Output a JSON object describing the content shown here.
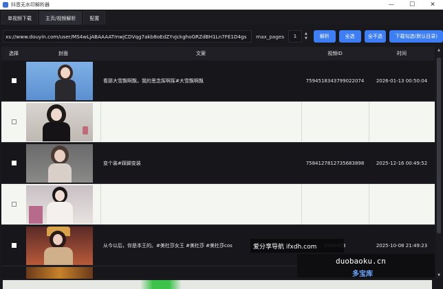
{
  "window": {
    "title": "抖音无水印解析器",
    "min_glyph": "—",
    "max_glyph": "☐",
    "close_glyph": "✕"
  },
  "tabs": [
    "单视频下载",
    "主页/视频解析",
    "配置"
  ],
  "toolbar": {
    "url_value": "xs://www.douyin.com/user/MS4wLjABAAAATmwjCDVqg7akb8oEdZYvJckghoGRZdBH1Ln7FE1D4gs",
    "max_pages_label": "max_pages",
    "max_pages_value": "1",
    "parse_button": "解析",
    "select_all_button": "全选",
    "select_none_button": "全不选",
    "download_selected_button": "下载勾选(默认目录)"
  },
  "table": {
    "headers": [
      "选择",
      "封面",
      "文案",
      "视频ID",
      "时间"
    ],
    "rows": [
      {
        "text": "看那大雪飘啊飘，我的思念挥啊挥#大雪飘啊飘",
        "video_id": "7594518343799022074",
        "time": "2026-01-13 00:50:04",
        "theme": "dark"
      },
      {
        "text": "",
        "video_id": "",
        "time": "",
        "theme": "light"
      },
      {
        "text": "变个装#踩脚变装",
        "video_id": "7584127812735683898",
        "time": "2025-12-16 00:49:52",
        "theme": "dark"
      },
      {
        "text": "",
        "video_id": "",
        "time": "",
        "theme": "light"
      },
      {
        "text": "从今以后，你是本王的。#美杜莎女王 #美杜莎 #美杜莎cos",
        "video_id": "0489403",
        "time": "2025-10-08 21:49:23",
        "theme": "dark"
      }
    ]
  },
  "watermarks": {
    "nav_text": "爱分享导航 ifxdh.com",
    "site_url": "duobaoku.cn",
    "site_name": "多宝库"
  },
  "colors": {
    "accent": "#3d7ef5",
    "progress": "#3dc24a"
  }
}
